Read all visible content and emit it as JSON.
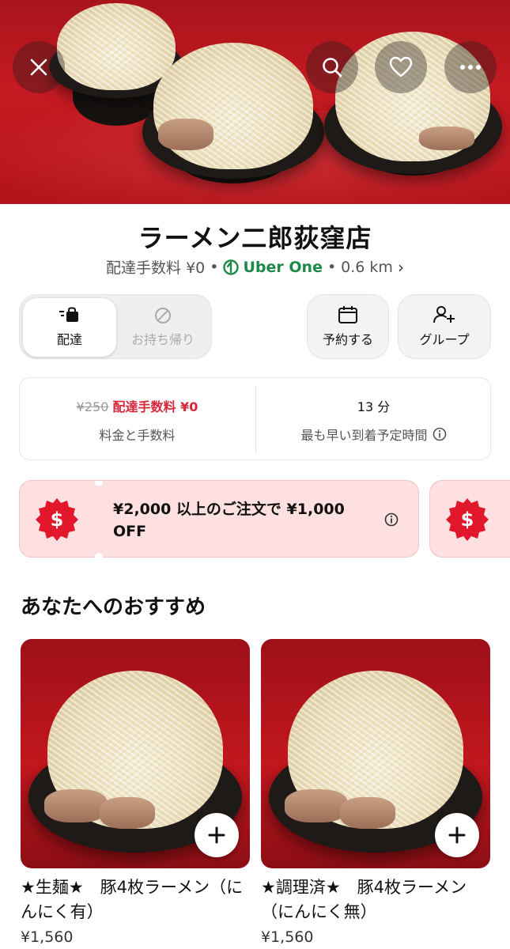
{
  "header_buttons": {
    "close_icon": "close-icon",
    "search_icon": "search-icon",
    "favorite_icon": "heart-icon",
    "more_icon": "more-icon"
  },
  "store": {
    "name": "ラーメン二郎荻窪店",
    "delivery_fee_label": "配達手数料 ¥0",
    "separator": "•",
    "uber_one": "Uber One",
    "distance": "0.6 km",
    "chevron": "›"
  },
  "mode_toggle": {
    "delivery": "配達",
    "pickup": "お持ち帰り"
  },
  "actions": {
    "schedule": "予約する",
    "group": "グループ"
  },
  "info": {
    "old_fee": "¥250",
    "new_fee": "配達手数料 ¥0",
    "fee_label": "料金と手数料",
    "eta_value": "13 分",
    "eta_label": "最も早い到着予定時間"
  },
  "promo": {
    "text": "¥2,000 以上のご注文で ¥1,000 OFF",
    "badge_symbol": "$"
  },
  "section_title": "あなたへのおすすめ",
  "items": [
    {
      "name": "★生麺★　豚4枚ラーメン（にんにく有）",
      "price": "¥1,560"
    },
    {
      "name": "★調理済★　豚4枚ラーメン（にんにく無）",
      "price": "¥1,560"
    }
  ],
  "colors": {
    "accent_red": "#d6283a",
    "uber_one_green": "#1c8a46",
    "promo_bg": "#fde0df"
  }
}
